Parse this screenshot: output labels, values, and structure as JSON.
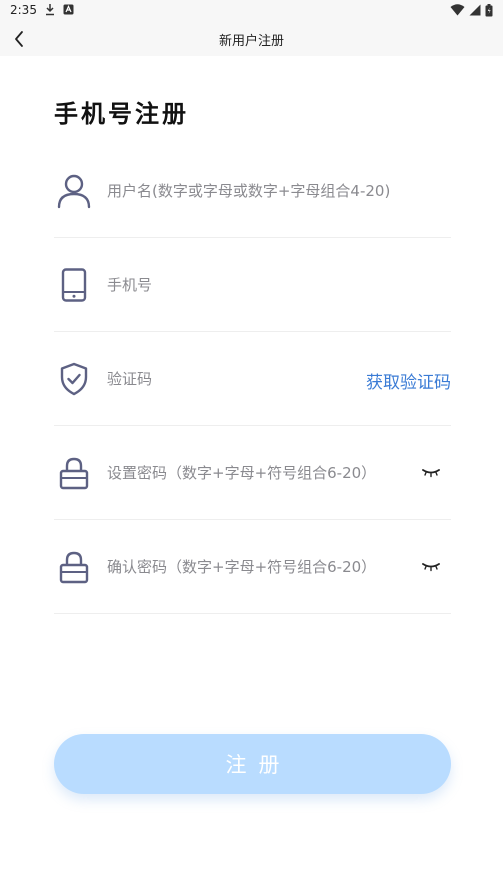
{
  "status_bar": {
    "time": "2:35",
    "icons": [
      "download-icon",
      "a-icon",
      "wifi-icon",
      "signal-icon",
      "battery-icon"
    ]
  },
  "nav": {
    "title": "新用户注册",
    "back_icon": "chevron-left-icon"
  },
  "heading": "手机号注册",
  "form": {
    "username": {
      "placeholder": "用户名(数字或字母或数字+字母组合4-20)",
      "icon": "user-icon"
    },
    "phone": {
      "placeholder": "手机号",
      "icon": "phone-icon"
    },
    "code": {
      "placeholder": "验证码",
      "icon": "shield-check-icon",
      "get_code_label": "获取验证码"
    },
    "password": {
      "placeholder": "设置密码（数字+字母+符号组合6-20）",
      "icon": "lock-icon",
      "toggle_icon": "eye-closed-icon"
    },
    "confirm": {
      "placeholder": "确认密码（数字+字母+符号组合6-20）",
      "icon": "lock-icon",
      "toggle_icon": "eye-closed-icon"
    }
  },
  "submit_label": "注册",
  "colors": {
    "accent_link": "#3a7bd5",
    "button_bg": "#b9dcff",
    "icon": "#5d6183"
  }
}
